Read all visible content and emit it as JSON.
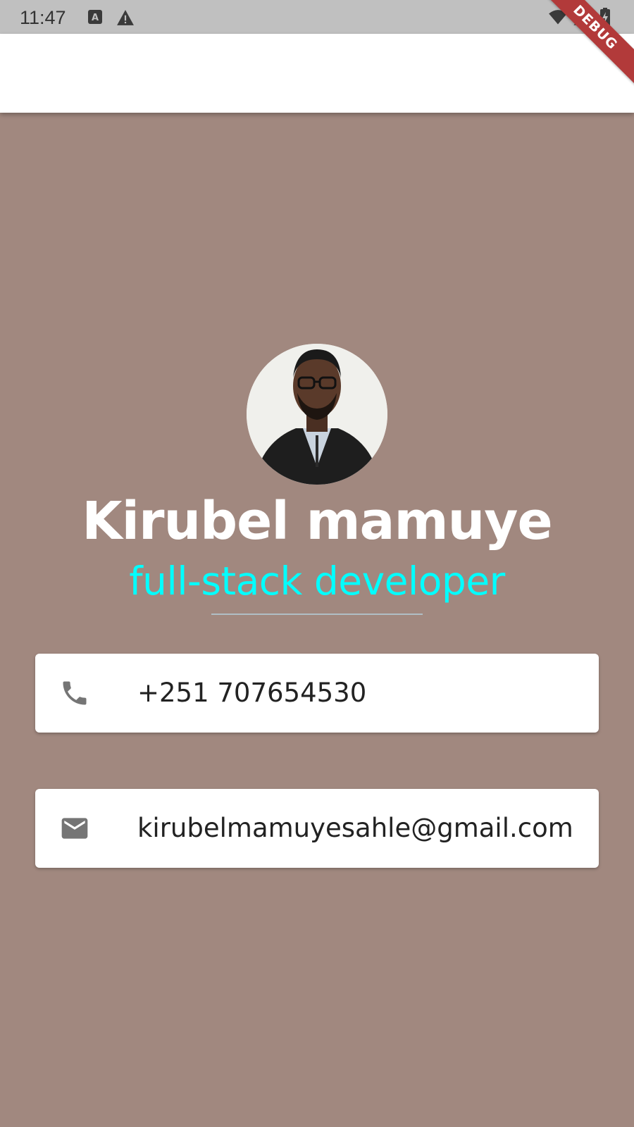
{
  "status_bar": {
    "time": "11:47",
    "left_icons": [
      "keyboard-a-icon",
      "warning-icon"
    ],
    "right_icons": [
      "wifi-icon",
      "signal-icon",
      "battery-charging-icon"
    ]
  },
  "debug_banner": "DEBUG",
  "profile": {
    "name": "Kirubel mamuye",
    "title": "full-stack developer"
  },
  "contacts": {
    "phone": {
      "icon": "phone-icon",
      "text": "+251 707654530"
    },
    "email": {
      "icon": "mail-icon",
      "text": "kirubelmamuyesahle@gmail.com"
    }
  },
  "colors": {
    "background": "#a1887f",
    "accent_title": "#00ffff",
    "app_bar": "#ffffff",
    "status_bar": "#c0c0c0"
  }
}
